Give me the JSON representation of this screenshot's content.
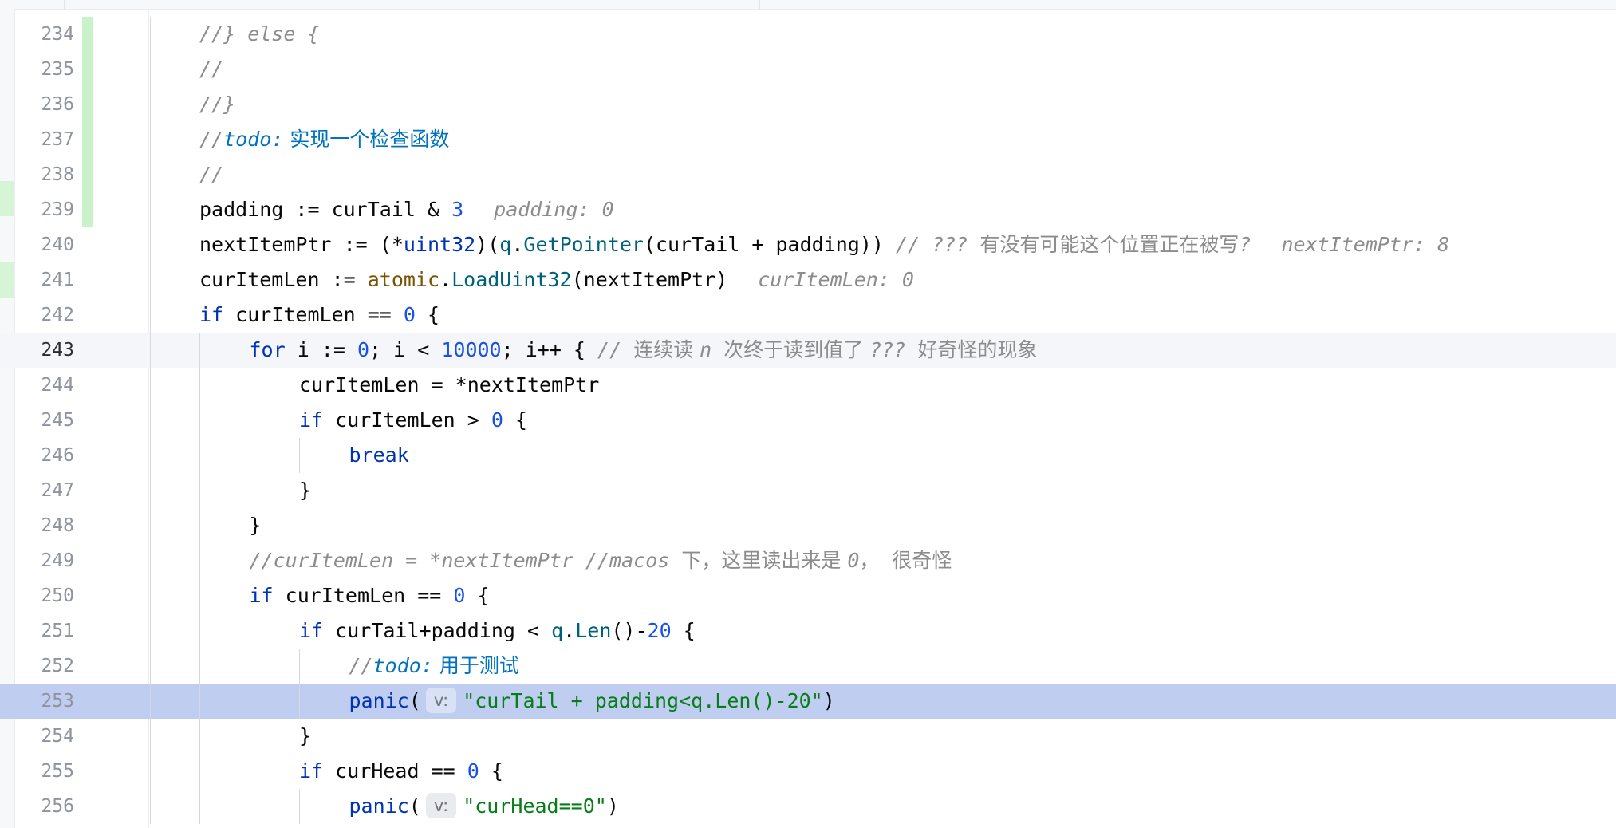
{
  "editor": {
    "lines": [
      {
        "num": "234",
        "indent": 1,
        "vcs": true,
        "tokens": [
          {
            "t": "//} else {",
            "c": "cm"
          }
        ]
      },
      {
        "num": "235",
        "indent": 1,
        "vcs": true,
        "tokens": [
          {
            "t": "//",
            "c": "cm"
          }
        ]
      },
      {
        "num": "236",
        "indent": 1,
        "vcs": true,
        "tokens": [
          {
            "t": "//}",
            "c": "cm"
          }
        ]
      },
      {
        "num": "237",
        "indent": 1,
        "vcs": true,
        "tokens": [
          {
            "t": "//",
            "c": "cm"
          },
          {
            "t": "todo:",
            "c": "todo"
          },
          {
            "t": " 实现一个检查函数",
            "c": "todo cjk"
          }
        ]
      },
      {
        "num": "238",
        "indent": 1,
        "vcs": true,
        "tokens": [
          {
            "t": "//",
            "c": "cm"
          }
        ]
      },
      {
        "num": "239",
        "indent": 1,
        "vcs": true,
        "tokens": [
          {
            "t": "padding := curTail & "
          },
          {
            "t": "3",
            "c": "num"
          }
        ],
        "inlay": "padding: 0"
      },
      {
        "num": "240",
        "indent": 1,
        "tokens": [
          {
            "t": "nextItemPtr := (*"
          },
          {
            "t": "uint32",
            "c": "kw"
          },
          {
            "t": ")("
          },
          {
            "t": "q",
            "c": "fn"
          },
          {
            "t": "."
          },
          {
            "t": "GetPointer",
            "c": "fn"
          },
          {
            "t": "(curTail + padding)) "
          },
          {
            "t": "// ??? ",
            "c": "cm"
          },
          {
            "t": "有没有可能这个位置正在被写",
            "c": "cm cjk"
          },
          {
            "t": "?",
            "c": "cm"
          }
        ],
        "inlay": "nextItemPtr: 8"
      },
      {
        "num": "241",
        "indent": 1,
        "tokens": [
          {
            "t": "curItemLen := "
          },
          {
            "t": "atomic",
            "c": "pkg"
          },
          {
            "t": "."
          },
          {
            "t": "LoadUint32",
            "c": "fn"
          },
          {
            "t": "(nextItemPtr)"
          }
        ],
        "inlay": "curItemLen: 0"
      },
      {
        "num": "242",
        "indent": 1,
        "tokens": [
          {
            "t": "if",
            "c": "kw"
          },
          {
            "t": " curItemLen == "
          },
          {
            "t": "0",
            "c": "num"
          },
          {
            "t": " {"
          }
        ]
      },
      {
        "num": "243",
        "indent": 2,
        "caret": true,
        "tokens": [
          {
            "t": "for",
            "c": "kw"
          },
          {
            "t": " i := "
          },
          {
            "t": "0",
            "c": "num"
          },
          {
            "t": "; i < "
          },
          {
            "t": "10000",
            "c": "num"
          },
          {
            "t": "; i++ { "
          },
          {
            "t": "// ",
            "c": "cm"
          },
          {
            "t": "连续读 ",
            "c": "cm cjk"
          },
          {
            "t": "n ",
            "c": "cm"
          },
          {
            "t": "次终于读到值了 ",
            "c": "cm cjk"
          },
          {
            "t": "??? ",
            "c": "cm"
          },
          {
            "t": "好奇怪的现象",
            "c": "cm cjk"
          }
        ]
      },
      {
        "num": "244",
        "indent": 3,
        "tokens": [
          {
            "t": "curItemLen = *nextItemPtr"
          }
        ]
      },
      {
        "num": "245",
        "indent": 3,
        "tokens": [
          {
            "t": "if",
            "c": "kw"
          },
          {
            "t": " curItemLen > "
          },
          {
            "t": "0",
            "c": "num"
          },
          {
            "t": " {"
          }
        ]
      },
      {
        "num": "246",
        "indent": 4,
        "tokens": [
          {
            "t": "break",
            "c": "kw"
          }
        ]
      },
      {
        "num": "247",
        "indent": 3,
        "tokens": [
          {
            "t": "}"
          }
        ]
      },
      {
        "num": "248",
        "indent": 2,
        "tokens": [
          {
            "t": "}"
          }
        ]
      },
      {
        "num": "249",
        "indent": 2,
        "tokens": [
          {
            "t": "//curItemLen = *nextItemPtr //macos ",
            "c": "cm"
          },
          {
            "t": "下，这里读出来是 ",
            "c": "cm cjk"
          },
          {
            "t": "0",
            "c": "cm"
          },
          {
            "t": "，  很奇怪",
            "c": "cm cjk"
          }
        ]
      },
      {
        "num": "250",
        "indent": 2,
        "tokens": [
          {
            "t": "if",
            "c": "kw"
          },
          {
            "t": " curItemLen == "
          },
          {
            "t": "0",
            "c": "num"
          },
          {
            "t": " {"
          }
        ]
      },
      {
        "num": "251",
        "indent": 3,
        "tokens": [
          {
            "t": "if",
            "c": "kw"
          },
          {
            "t": " curTail+padding < "
          },
          {
            "t": "q",
            "c": "fn"
          },
          {
            "t": "."
          },
          {
            "t": "Len",
            "c": "fn"
          },
          {
            "t": "()-"
          },
          {
            "t": "20",
            "c": "num"
          },
          {
            "t": " {"
          }
        ]
      },
      {
        "num": "252",
        "indent": 4,
        "tokens": [
          {
            "t": "//",
            "c": "cm"
          },
          {
            "t": "todo:",
            "c": "todo"
          },
          {
            "t": " 用于测试",
            "c": "todo cjk"
          }
        ]
      },
      {
        "num": "253",
        "indent": 4,
        "hl": true,
        "tokens": [
          {
            "t": "panic",
            "c": "kw"
          },
          {
            "t": "("
          },
          {
            "hint": "v:"
          },
          {
            "t": "\"curTail + padding<q.Len()-20\"",
            "c": "str"
          },
          {
            "t": ")"
          }
        ]
      },
      {
        "num": "254",
        "indent": 3,
        "tokens": [
          {
            "t": "}"
          }
        ]
      },
      {
        "num": "255",
        "indent": 3,
        "tokens": [
          {
            "t": "if",
            "c": "kw"
          },
          {
            "t": " curHead == "
          },
          {
            "t": "0",
            "c": "num"
          },
          {
            "t": " {"
          }
        ]
      },
      {
        "num": "256",
        "indent": 4,
        "tokens": [
          {
            "t": "panic",
            "c": "kw"
          },
          {
            "t": "("
          },
          {
            "hint": "v:"
          },
          {
            "t": "\"curHead==0\"",
            "c": "str"
          },
          {
            "t": ")"
          }
        ]
      }
    ]
  }
}
